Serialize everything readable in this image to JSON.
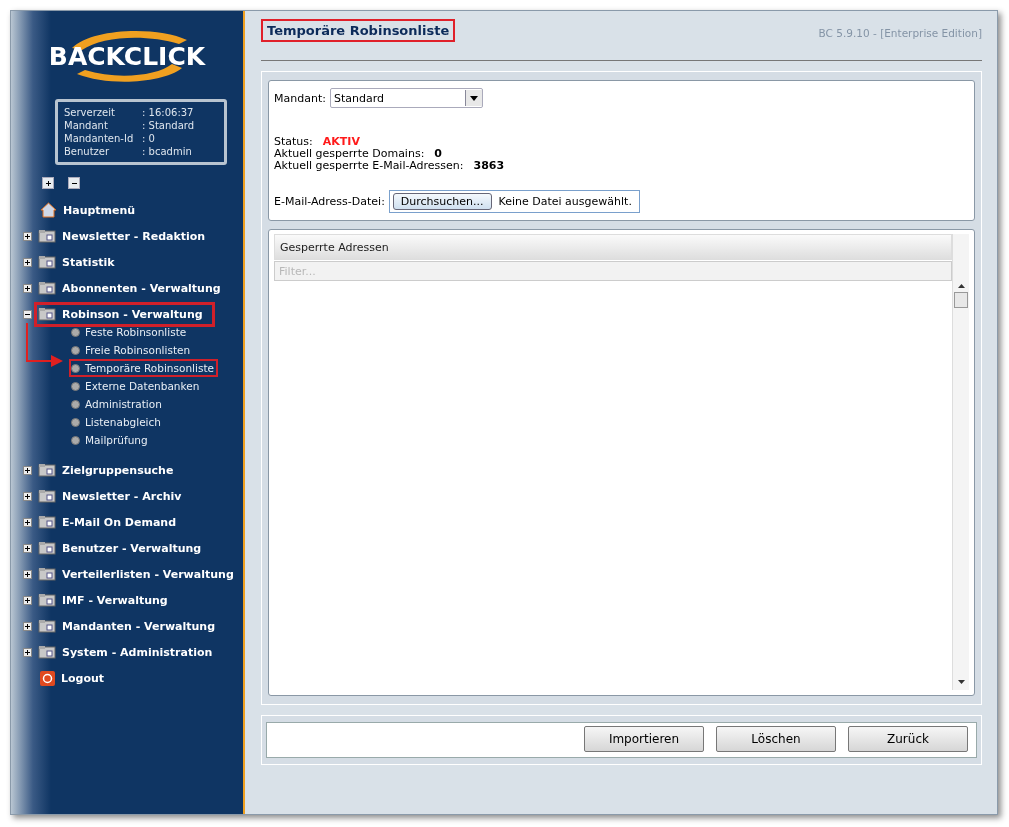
{
  "logo": {
    "text": "BACKCLICK"
  },
  "server_info": [
    {
      "label": "Serverzeit",
      "separator": ":",
      "value": "16:06:37"
    },
    {
      "label": "Mandant",
      "separator": ":",
      "value": "Standard"
    },
    {
      "label": "Mandanten-Id",
      "separator": ":",
      "value": "0"
    },
    {
      "label": "Benutzer",
      "separator": ":",
      "value": "bcadmin"
    }
  ],
  "sidebar": {
    "items": [
      {
        "kind": "home",
        "label": "Hauptmenü",
        "highlighted": false
      },
      {
        "kind": "group",
        "label": "Newsletter - Redaktion",
        "expanded": false,
        "highlighted": false
      },
      {
        "kind": "group",
        "label": "Statistik",
        "expanded": false,
        "highlighted": false
      },
      {
        "kind": "group",
        "label": "Abonnenten - Verwaltung",
        "expanded": false,
        "highlighted": false
      },
      {
        "kind": "group",
        "label": "Robinson - Verwaltung",
        "expanded": true,
        "highlighted": true,
        "children": [
          {
            "label": "Feste Robinsonliste",
            "highlighted": false
          },
          {
            "label": "Freie Robinsonlisten",
            "highlighted": false
          },
          {
            "label": "Temporäre Robinsonliste",
            "highlighted": true
          },
          {
            "label": "Externe Datenbanken",
            "highlighted": false
          },
          {
            "label": "Administration",
            "highlighted": false
          },
          {
            "label": "Listenabgleich",
            "highlighted": false
          },
          {
            "label": "Mailprüfung",
            "highlighted": false
          }
        ]
      },
      {
        "kind": "group",
        "label": "Zielgruppensuche",
        "expanded": false,
        "highlighted": false
      },
      {
        "kind": "group",
        "label": "Newsletter - Archiv",
        "expanded": false,
        "highlighted": false
      },
      {
        "kind": "group",
        "label": "E-Mail On Demand",
        "expanded": false,
        "highlighted": false
      },
      {
        "kind": "group",
        "label": "Benutzer - Verwaltung",
        "expanded": false,
        "highlighted": false
      },
      {
        "kind": "group",
        "label": "Verteilerlisten - Verwaltung",
        "expanded": false,
        "highlighted": false
      },
      {
        "kind": "group",
        "label": "IMF - Verwaltung",
        "expanded": false,
        "highlighted": false
      },
      {
        "kind": "group",
        "label": "Mandanten - Verwaltung",
        "expanded": false,
        "highlighted": false
      },
      {
        "kind": "group",
        "label": "System - Administration",
        "expanded": false,
        "highlighted": false
      },
      {
        "kind": "logout",
        "label": "Logout",
        "highlighted": false
      }
    ]
  },
  "page": {
    "title": "Temporäre Robinsonliste",
    "title_highlighted": true,
    "version": "BC 5.9.10 - [Enterprise Edition]"
  },
  "form": {
    "mandant_label": "Mandant:",
    "mandant_value": "Standard",
    "stats": [
      {
        "label": "Status:",
        "value": "AKTIV",
        "kind": "status"
      },
      {
        "label": "Aktuell gesperrte Domains:",
        "value": "0",
        "kind": "count"
      },
      {
        "label": "Aktuell gesperrte E-Mail-Adressen:",
        "value": "3863",
        "kind": "count"
      }
    ],
    "file_label": "E-Mail-Adress-Datei:",
    "browse_button": "Durchsuchen...",
    "file_status": "Keine Datei ausgewählt."
  },
  "table": {
    "columns": [
      "Gesperrte Adressen"
    ],
    "filter_placeholder": "Filter..."
  },
  "buttons": [
    "Importieren",
    "Löschen",
    "Zurück"
  ]
}
